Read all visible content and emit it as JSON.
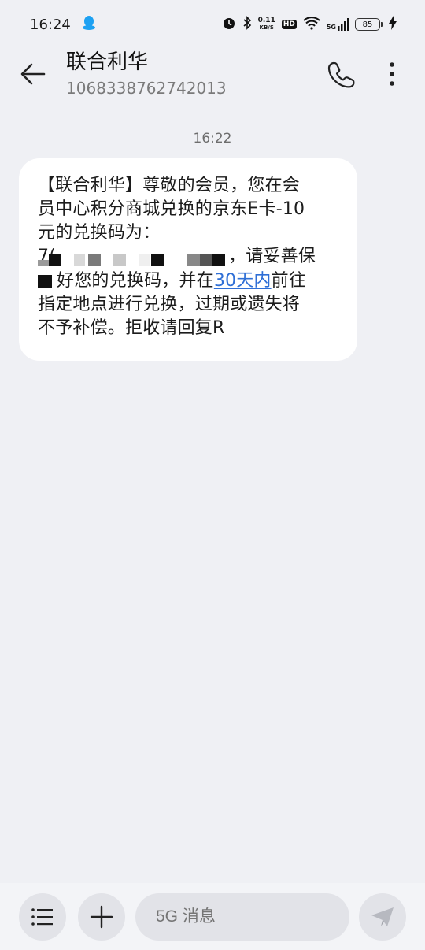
{
  "status_bar": {
    "time": "16:24",
    "speed_value": "0.11",
    "speed_unit": "KB/S",
    "hd": "HD",
    "network": "5G",
    "battery": "85"
  },
  "header": {
    "contact_name": "联合利华",
    "phone_number": "1068338762742013"
  },
  "conversation": {
    "timestamp": "16:22",
    "message": {
      "line1": "【联合利华】尊敬的会员，您在会",
      "line2": "员中心积分商城兑换的京东E卡-10",
      "line3": "元的兑换码为：",
      "code_fragment": "7(",
      "line4_suffix": "，请妥善保",
      "line5_prefix": "好您的兑换码，并在",
      "link_text": "30天内",
      "line5_suffix": "前往",
      "line6": "指定地点进行兑换，过期或遗失将",
      "line7": "不予补偿。拒收请回复R"
    }
  },
  "composer": {
    "placeholder": "5G 消息"
  },
  "colors": {
    "background": "#eff0f4",
    "bubble": "#ffffff",
    "link": "#2f6fd6",
    "button_bg": "#e2e3e8"
  }
}
